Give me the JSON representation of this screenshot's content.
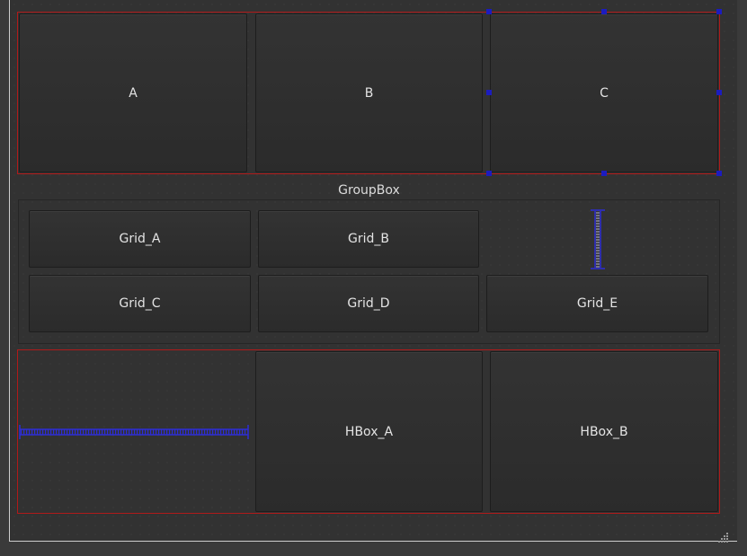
{
  "top_row": {
    "buttons": [
      {
        "label": "A"
      },
      {
        "label": "B"
      },
      {
        "label": "C"
      }
    ]
  },
  "groupbox": {
    "title": "GroupBox",
    "buttons": {
      "a": "Grid_A",
      "b": "Grid_B",
      "c": "Grid_C",
      "d": "Grid_D",
      "e": "Grid_E"
    }
  },
  "hbox": {
    "buttons": [
      {
        "label": "HBox_A"
      },
      {
        "label": "HBox_B"
      }
    ]
  },
  "colors": {
    "layout_border": "#b01a1a",
    "selection_handle": "#1c1cbf",
    "spacer": "#1c1cbf",
    "background": "#323232"
  }
}
